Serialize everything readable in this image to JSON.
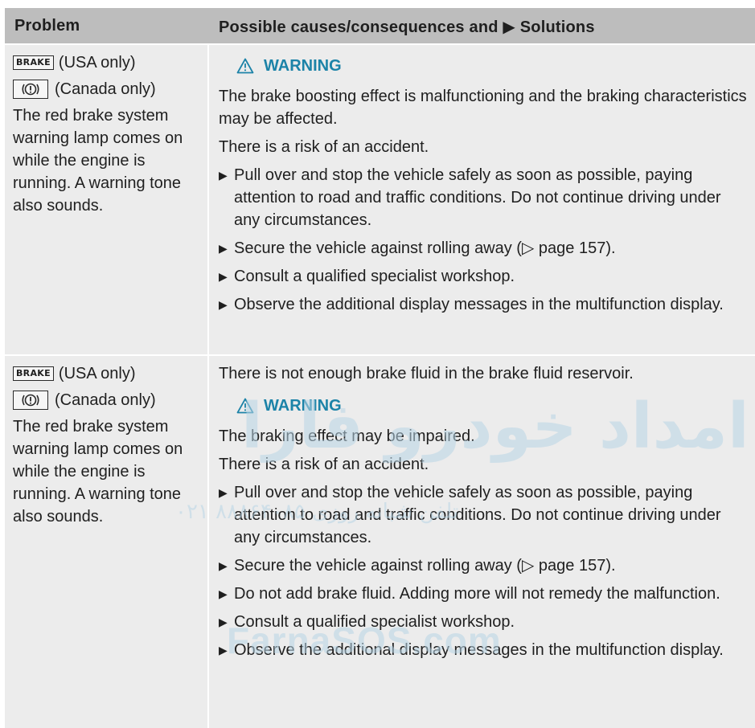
{
  "header": {
    "problem": "Problem",
    "solutions": "Possible causes/consequences and ▶ Solutions"
  },
  "icons": {
    "brake_label": "BRAKE",
    "brake_usa_suffix": "(USA only)",
    "canada_suffix": "(Canada only)"
  },
  "rows": [
    {
      "problem_text": "The red brake system warning lamp comes on while the engine is running. A warning tone also sounds.",
      "intro": "",
      "warning_label": "WARNING",
      "warning_paragraphs": [
        "The brake boosting effect is malfunctioning and the braking characteristics may be affected.",
        "There is a risk of an accident."
      ],
      "bullets": [
        "Pull over and stop the vehicle safely as soon as possible, paying attention to road and traffic conditions. Do not continue driving under any circumstances.",
        "Secure the vehicle against rolling away (▷ page 157).",
        "Consult a qualified specialist workshop.",
        "Observe the additional display messages in the multifunction display."
      ]
    },
    {
      "problem_text": "The red brake system warning lamp comes on while the engine is running. A warning tone also sounds.",
      "intro": "There is not enough brake fluid in the brake fluid reservoir.",
      "warning_label": "WARNING",
      "warning_paragraphs": [
        "The braking effect may be impaired.",
        "There is a risk of an accident."
      ],
      "bullets": [
        "Pull over and stop the vehicle safely as soon as possible, paying attention to road and traffic conditions. Do not continue driving under any circumstances.",
        "Secure the vehicle against rolling away (▷ page 157).",
        "Do not add brake fluid. Adding more will not remedy the malfunction.",
        "Consult a qualified specialist workshop.",
        "Observe the additional display messages in the multifunction display."
      ]
    }
  ],
  "watermark": {
    "farsi": "امداد خودرو فارا",
    "phone": "۰۲۱ ۸۸۸۶۴۰۸۵ تلفن شبانه روزی",
    "site": "FarnaSOS.com"
  },
  "colors": {
    "header_bg": "#bdbdbd",
    "row_bg": "#ececec",
    "warning": "#1c83a8"
  }
}
